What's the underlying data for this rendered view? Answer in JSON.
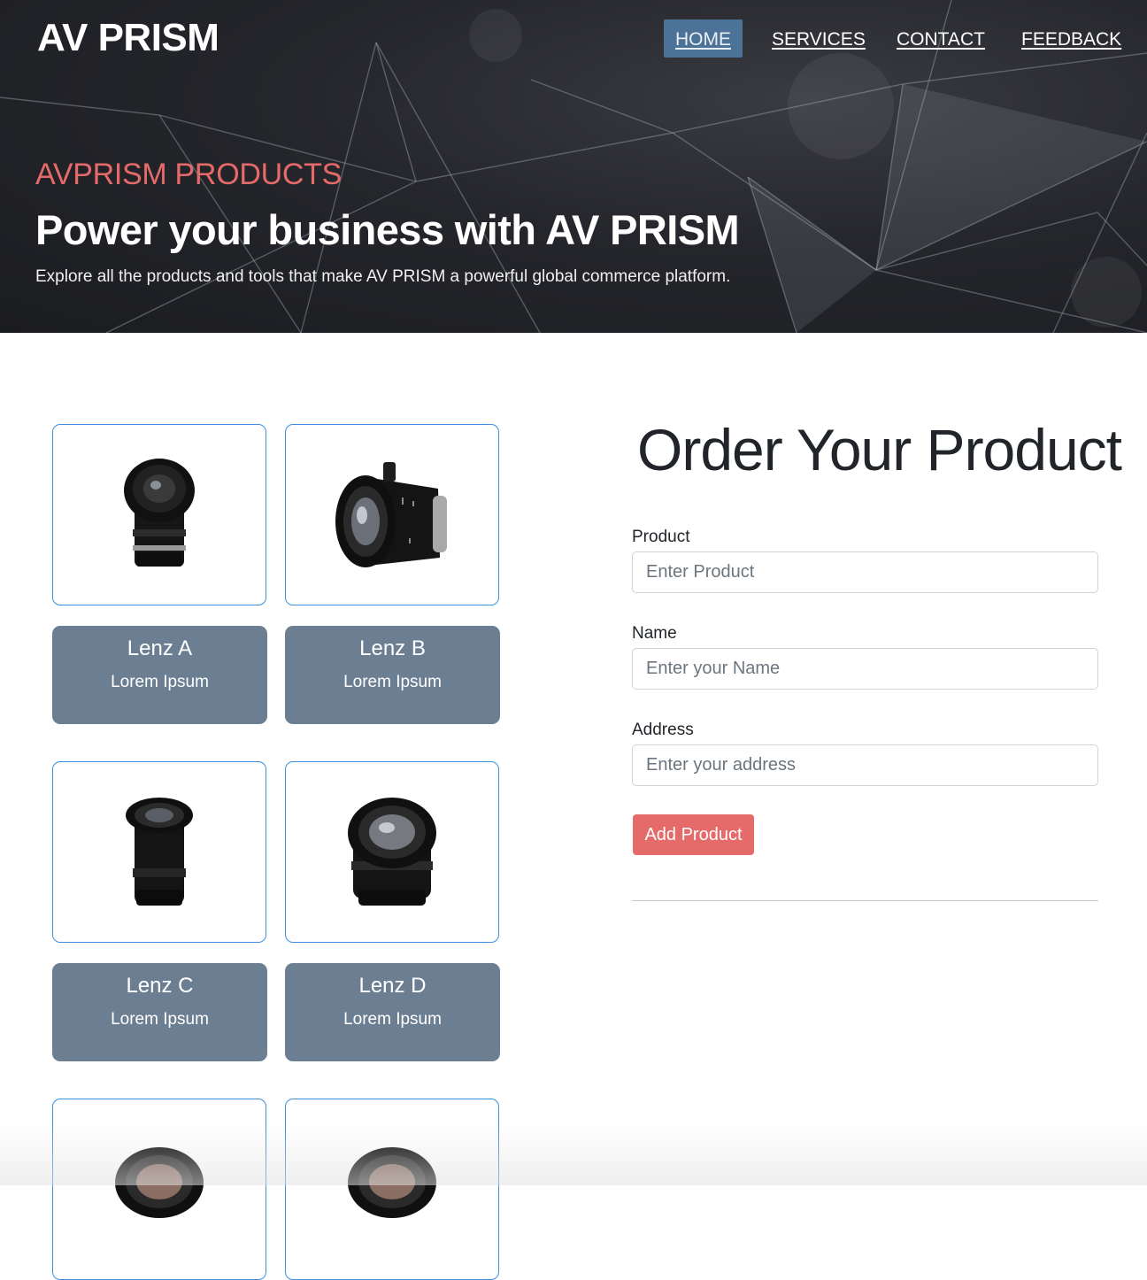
{
  "header": {
    "brand": "AV PRISM",
    "nav": [
      {
        "label": "HOME",
        "active": true
      },
      {
        "label": "SERVICES",
        "active": false
      },
      {
        "label": "CONTACT",
        "active": false
      },
      {
        "label": "FEEDBACK",
        "active": false
      }
    ]
  },
  "hero": {
    "kicker": "AVPRISM PRODUCTS",
    "title": "Power your business with AV PRISM",
    "subtitle": "Explore all the products and tools that make AV PRISM a powerful global commerce platform."
  },
  "products": [
    {
      "name": "Lenz A",
      "desc": "Lorem Ipsum",
      "icon": "camera-lens-image"
    },
    {
      "name": "Lenz B",
      "desc": "Lorem Ipsum",
      "icon": "camera-lens-image"
    },
    {
      "name": "Lenz C",
      "desc": "Lorem Ipsum",
      "icon": "camera-lens-image"
    },
    {
      "name": "Lenz D",
      "desc": "Lorem Ipsum",
      "icon": "camera-lens-image"
    },
    {
      "name": "",
      "desc": "",
      "icon": "camera-lens-image"
    },
    {
      "name": "",
      "desc": "",
      "icon": "camera-lens-image"
    }
  ],
  "order_form": {
    "title": "Order Your Product",
    "fields": [
      {
        "label": "Product",
        "placeholder": "Enter Product",
        "value": ""
      },
      {
        "label": "Name",
        "placeholder": "Enter your Name",
        "value": ""
      },
      {
        "label": "Address",
        "placeholder": "Enter your address",
        "value": ""
      }
    ],
    "submit_label": "Add Product"
  },
  "colors": {
    "accent": "#e56a6a",
    "nav_active": "#4c7397",
    "card_info_bg": "#6c7f92",
    "card_border": "#3d8fe0"
  }
}
